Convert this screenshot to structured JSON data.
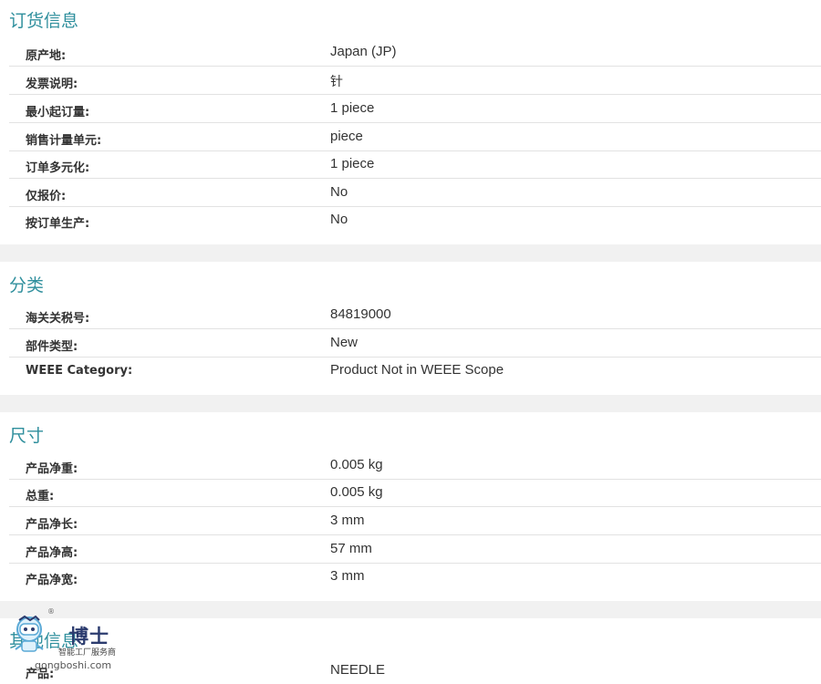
{
  "sections": [
    {
      "title": "订货信息",
      "rows": [
        {
          "label": "原产地:",
          "value": "Japan (JP)"
        },
        {
          "label": "发票说明:",
          "value": "针"
        },
        {
          "label": "最小起订量:",
          "value": "1 piece"
        },
        {
          "label": "销售计量单元:",
          "value": "piece"
        },
        {
          "label": "订单多元化:",
          "value": "1 piece"
        },
        {
          "label": "仅报价:",
          "value": "No"
        },
        {
          "label": "按订单生产:",
          "value": "No"
        }
      ]
    },
    {
      "title": "分类",
      "rows": [
        {
          "label": "海关关税号:",
          "value": "84819000"
        },
        {
          "label": "部件类型:",
          "value": "New"
        },
        {
          "label": "WEEE Category:",
          "value": "Product Not in WEEE Scope"
        }
      ]
    },
    {
      "title": "尺寸",
      "rows": [
        {
          "label": "产品净重:",
          "value": "0.005 kg"
        },
        {
          "label": "总重:",
          "value": "0.005 kg"
        },
        {
          "label": "产品净长:",
          "value": "3 mm"
        },
        {
          "label": "产品净高:",
          "value": "57 mm"
        },
        {
          "label": "产品净宽:",
          "value": "3 mm"
        }
      ]
    },
    {
      "title": "其他信息",
      "rows": [
        {
          "label": "产品:",
          "value": "NEEDLE"
        }
      ]
    }
  ],
  "watermark": {
    "brand": "博士",
    "tagline": "智能工厂服务商",
    "url": "gongboshi.com",
    "registered": "®"
  },
  "colors": {
    "section_title": "#2f8f9d",
    "divider": "#e2e2e2",
    "gap_band": "#f1f1f1"
  }
}
